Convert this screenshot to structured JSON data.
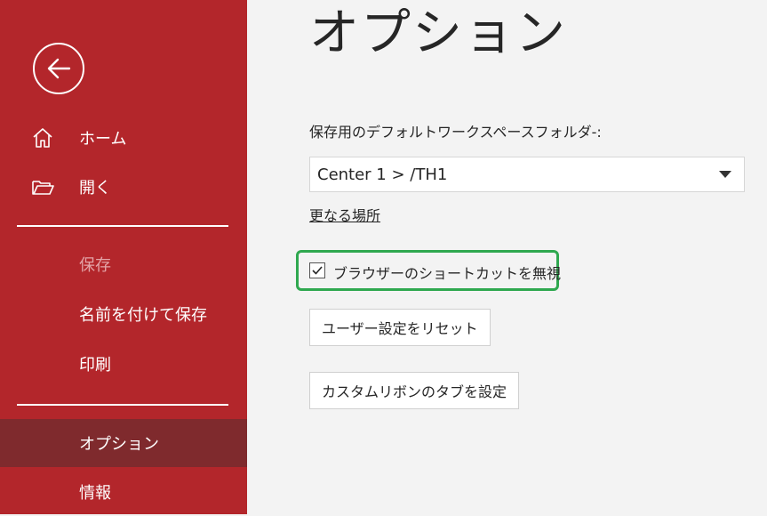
{
  "sidebar": {
    "back_icon": "back-arrow-icon",
    "items": [
      {
        "label": "ホーム",
        "icon": "home-icon"
      },
      {
        "label": "開く",
        "icon": "folder-open-icon"
      },
      {
        "label": "保存",
        "state": "disabled"
      },
      {
        "label": "名前を付けて保存"
      },
      {
        "label": "印刷"
      },
      {
        "label": "オプション",
        "state": "active"
      },
      {
        "label": "情報"
      }
    ],
    "colors": {
      "background": "#b3262b",
      "active": "#7f2a2d",
      "disabled_text": "#e3a3a6"
    }
  },
  "main": {
    "title": "オプション",
    "folder_label": "保存用のデフォルトワークスペースフォルダ-:",
    "folder_value": "Center 1 > /TH1",
    "more_link": "更なる場所",
    "ignore_shortcuts": {
      "label": "ブラウザーのショートカットを無視",
      "checked": true
    },
    "reset_button": "ユーザー設定をリセット",
    "ribbon_button": "カスタムリボンのタブを設定",
    "colors": {
      "highlight": "#2fa84f"
    }
  }
}
